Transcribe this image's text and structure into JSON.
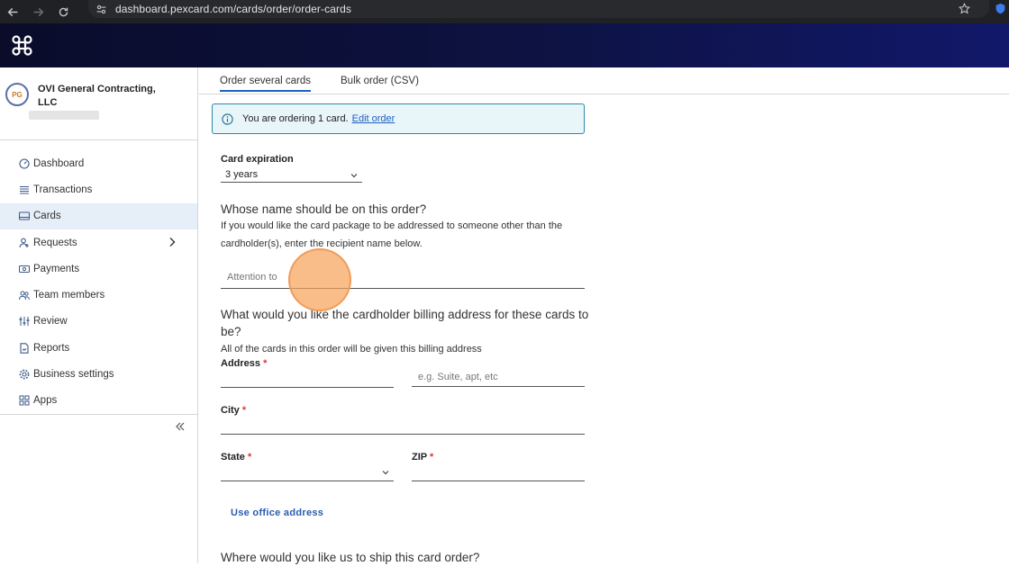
{
  "browser": {
    "url": "dashboard.pexcard.com/cards/order/order-cards"
  },
  "sidebar": {
    "company_name": "OVI General Contracting, LLC",
    "company_initials": "PG",
    "items": [
      {
        "label": "Dashboard",
        "icon": "dashboard-gauge-icon"
      },
      {
        "label": "Transactions",
        "icon": "list-icon"
      },
      {
        "label": "Cards",
        "icon": "card-icon",
        "active": true
      },
      {
        "label": "Requests",
        "icon": "requests-icon",
        "has_chevron": true
      },
      {
        "label": "Payments",
        "icon": "payments-icon"
      },
      {
        "label": "Team members",
        "icon": "team-icon"
      },
      {
        "label": "Review",
        "icon": "sliders-icon"
      },
      {
        "label": "Reports",
        "icon": "report-icon"
      },
      {
        "label": "Business settings",
        "icon": "gear-icon"
      },
      {
        "label": "Apps",
        "icon": "apps-grid-icon"
      }
    ]
  },
  "tabs": [
    {
      "label": "Order several cards",
      "active": true
    },
    {
      "label": "Bulk order (CSV)",
      "active": false
    }
  ],
  "info": {
    "text": "You are ordering 1 card.",
    "link": "Edit order"
  },
  "form": {
    "expiration_label": "Card expiration",
    "expiration_value": "3 years",
    "name_heading": "Whose name should be on this order?",
    "name_desc": "If you would like the card package to be addressed to someone other than the cardholder(s), enter the recipient name below.",
    "attention_placeholder": "Attention to",
    "billing_heading": "What would you like the cardholder billing address for these cards to be?",
    "billing_desc": "All of the cards in this order will be given this billing address",
    "address_label": "Address",
    "address2_placeholder": "e.g. Suite, apt, etc",
    "city_label": "City",
    "state_label": "State",
    "zip_label": "ZIP",
    "required_mark": "*",
    "office_link": "Use office address",
    "ship_heading": "Where would you like us to ship this card order?"
  }
}
